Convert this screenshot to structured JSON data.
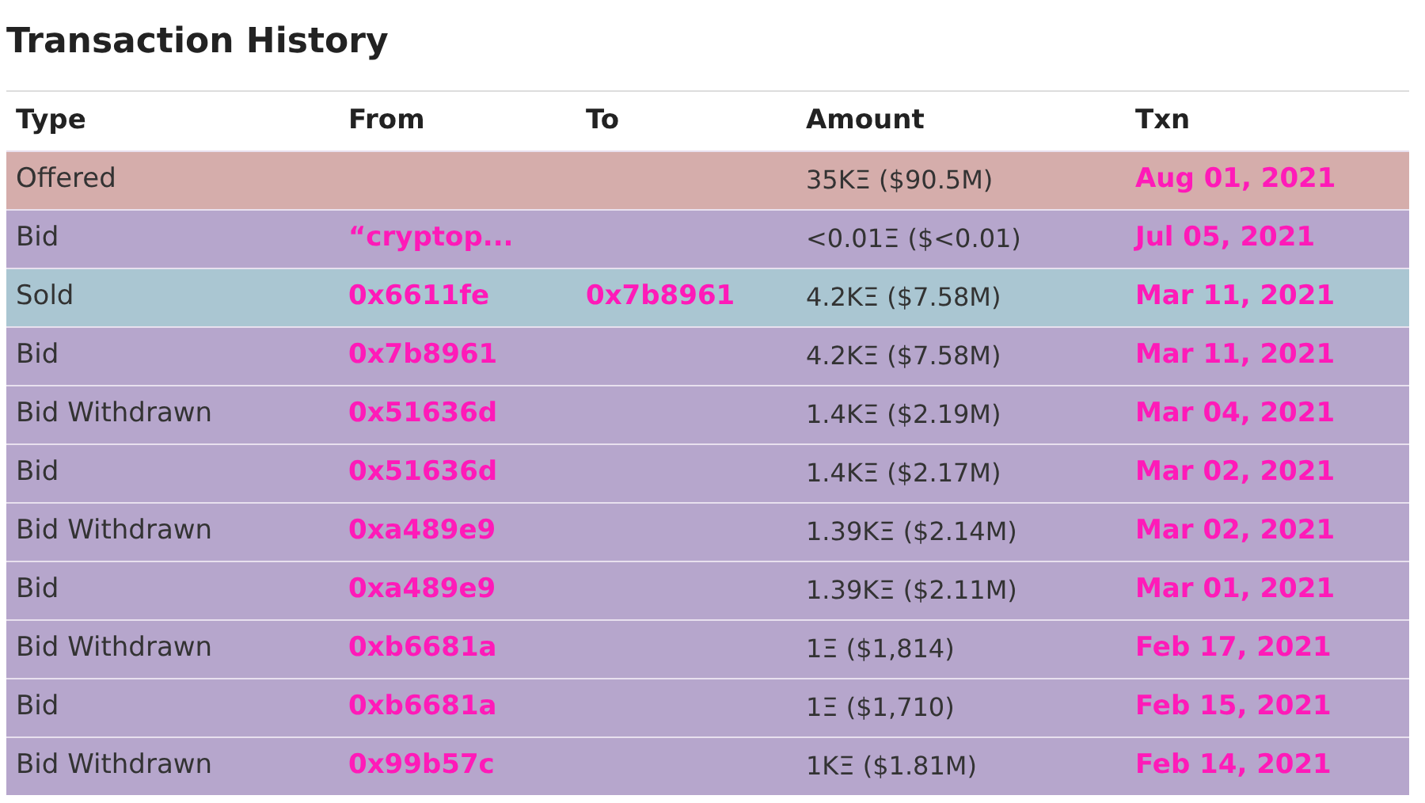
{
  "title": "Transaction History",
  "table": {
    "columns": [
      "Type",
      "From",
      "To",
      "Amount",
      "Txn"
    ],
    "rows": [
      {
        "type": "Offered",
        "from": "",
        "to": "",
        "amount": "35KΞ ($90.5M)",
        "txn": "Aug 01, 2021",
        "color": "#d5adab"
      },
      {
        "type": "Bid",
        "from": "“cryptop...",
        "to": "",
        "amount": "<0.01Ξ ($<0.01)",
        "txn": "Jul 05, 2021",
        "color": "#b6a6cc"
      },
      {
        "type": "Sold",
        "from": "0x6611fe",
        "to": "0x7b8961",
        "amount": "4.2KΞ ($7.58M)",
        "txn": "Mar 11, 2021",
        "color": "#aac6d2"
      },
      {
        "type": "Bid",
        "from": "0x7b8961",
        "to": "",
        "amount": "4.2KΞ ($7.58M)",
        "txn": "Mar 11, 2021",
        "color": "#b6a6cc"
      },
      {
        "type": "Bid Withdrawn",
        "from": "0x51636d",
        "to": "",
        "amount": "1.4KΞ ($2.19M)",
        "txn": "Mar 04, 2021",
        "color": "#b6a6cc"
      },
      {
        "type": "Bid",
        "from": "0x51636d",
        "to": "",
        "amount": "1.4KΞ ($2.17M)",
        "txn": "Mar 02, 2021",
        "color": "#b6a6cc"
      },
      {
        "type": "Bid Withdrawn",
        "from": "0xa489e9",
        "to": "",
        "amount": "1.39KΞ ($2.14M)",
        "txn": "Mar 02, 2021",
        "color": "#b6a6cc"
      },
      {
        "type": "Bid",
        "from": "0xa489e9",
        "to": "",
        "amount": "1.39KΞ ($2.11M)",
        "txn": "Mar 01, 2021",
        "color": "#b6a6cc"
      },
      {
        "type": "Bid Withdrawn",
        "from": "0xb6681a",
        "to": "",
        "amount": "1Ξ ($1,814)",
        "txn": "Feb 17, 2021",
        "color": "#b6a6cc"
      },
      {
        "type": "Bid",
        "from": "0xb6681a",
        "to": "",
        "amount": "1Ξ ($1,710)",
        "txn": "Feb 15, 2021",
        "color": "#b6a6cc"
      },
      {
        "type": "Bid Withdrawn",
        "from": "0x99b57c",
        "to": "",
        "amount": "1KΞ ($1.81M)",
        "txn": "Feb 14, 2021",
        "color": "#b6a6cc"
      }
    ]
  }
}
